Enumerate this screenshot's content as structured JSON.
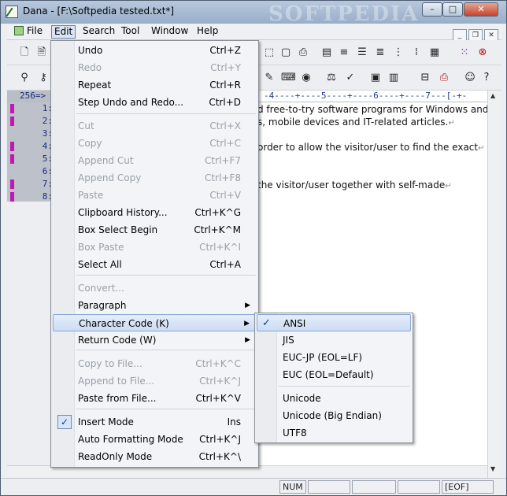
{
  "window": {
    "title": "Dana - [F:\\Softpedia tested.txt*]",
    "watermark": "SOFTPEDIA",
    "min": "–",
    "max": "□",
    "close": "✕"
  },
  "menubar": [
    "File",
    "Edit",
    "Search",
    "Tool",
    "Window",
    "Help"
  ],
  "mdi": {
    "min": "_",
    "restore": "❐",
    "close": "✕"
  },
  "ruler": {
    "col": "256=>",
    "marks": "-4----+----5----+----6----+----7---[-+-"
  },
  "gutter": [
    "1:",
    "2:",
    "3:",
    "4:",
    "5:",
    "6:",
    "7:",
    "8:"
  ],
  "editor_lines": [
    "d free-to-try software programs for Windows and",
    "s, mobile devices and IT-related articles.",
    "order to allow the visitor/user to find the exact",
    "the visitor/user together with self-made"
  ],
  "ret_glyph": "↵",
  "edit_menu": [
    {
      "label": "Undo",
      "shortcut": "Ctrl+Z"
    },
    {
      "label": "Redo",
      "shortcut": "Ctrl+Y",
      "disabled": true
    },
    {
      "label": "Repeat",
      "shortcut": "Ctrl+R"
    },
    {
      "label": "Step Undo and Redo...",
      "shortcut": "Ctrl+D"
    },
    {
      "label": "Cut",
      "shortcut": "Ctrl+X",
      "disabled": true
    },
    {
      "label": "Copy",
      "shortcut": "Ctrl+C",
      "disabled": true
    },
    {
      "label": "Append Cut",
      "shortcut": "Ctrl+F7",
      "disabled": true
    },
    {
      "label": "Append Copy",
      "shortcut": "Ctrl+F8",
      "disabled": true
    },
    {
      "label": "Paste",
      "shortcut": "Ctrl+V",
      "disabled": true
    },
    {
      "label": "Clipboard History...",
      "shortcut": "Ctrl+K^G"
    },
    {
      "label": "Box Select Begin",
      "shortcut": "Ctrl+K^M"
    },
    {
      "label": "Box Paste",
      "shortcut": "Ctrl+K^I",
      "disabled": true
    },
    {
      "label": "Select All",
      "shortcut": "Ctrl+A"
    },
    {
      "label": "Convert...",
      "shortcut": "",
      "disabled": true
    },
    {
      "label": "Paragraph",
      "shortcut": "",
      "submenu": true
    },
    {
      "label": "Character Code (K)",
      "shortcut": "",
      "submenu": true,
      "highlighted": true
    },
    {
      "label": "Return Code (W)",
      "shortcut": "",
      "submenu": true
    },
    {
      "label": "Copy to File...",
      "shortcut": "Ctrl+K^C",
      "disabled": true
    },
    {
      "label": "Append to File...",
      "shortcut": "Ctrl+K^J",
      "disabled": true
    },
    {
      "label": "Paste from File...",
      "shortcut": "Ctrl+K^V"
    },
    {
      "label": "Insert Mode",
      "shortcut": "Ins",
      "checked": true
    },
    {
      "label": "Auto Formatting Mode",
      "shortcut": "Ctrl+K^J"
    },
    {
      "label": "ReadOnly Mode",
      "shortcut": "Ctrl+K^\\"
    }
  ],
  "char_menu": [
    {
      "label": "ANSI",
      "checked": true,
      "highlighted": true
    },
    {
      "label": "JIS"
    },
    {
      "label": "EUC-JP (EOL=LF)"
    },
    {
      "label": "EUC (EOL=Default)"
    },
    {
      "label": "Unicode"
    },
    {
      "label": "Unicode (Big Endian)"
    },
    {
      "label": "UTF8"
    }
  ],
  "check_glyph": "✓",
  "submenu_glyph": "▶",
  "status": {
    "num": "NUM",
    "eof": "[EOF]"
  }
}
